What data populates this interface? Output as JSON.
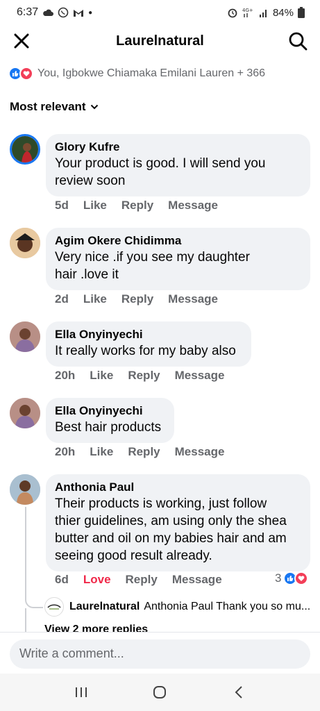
{
  "status_bar": {
    "time": "6:37",
    "battery": "84%"
  },
  "header": {
    "title": "Laurelnatural"
  },
  "reactions": {
    "summary": "You, Igbokwe Chiamaka Emilani Lauren + 366"
  },
  "sort": {
    "label": "Most relevant"
  },
  "comments": [
    {
      "author": "Glory Kufre",
      "lines": [
        "Your product is good. I will send you",
        "review soon"
      ],
      "time": "5d",
      "like": "Like",
      "reply": "Reply",
      "message": "Message"
    },
    {
      "author": "Agim Okere Chidimma",
      "lines": [
        "Very nice .if you see my daughter",
        "hair .love it"
      ],
      "time": "2d",
      "like": "Like",
      "reply": "Reply",
      "message": "Message"
    },
    {
      "author": "Ella Onyinyechi",
      "lines": [
        "It really works for my baby also"
      ],
      "time": "20h",
      "like": "Like",
      "reply": "Reply",
      "message": "Message"
    },
    {
      "author": "Ella Onyinyechi",
      "lines": [
        "Best hair products"
      ],
      "time": "20h",
      "like": "Like",
      "reply": "Reply",
      "message": "Message"
    },
    {
      "author": "Anthonia Paul",
      "lines": [
        "Their products is working, just follow",
        "thier guidelines, am using only the shea",
        "butter and oil on my babies hair and am",
        "seeing good result already."
      ],
      "time": "6d",
      "like": "Love",
      "reply": "Reply",
      "message": "Message",
      "reaction_count": "3"
    }
  ],
  "reply": {
    "author": "Laurelnatural",
    "text": "Anthonia Paul Thank you so mu..."
  },
  "view_more": "View 2 more replies",
  "composer": {
    "placeholder": "Write a comment..."
  },
  "colors": {
    "accent": "#1877f2",
    "love": "#f02849",
    "bubble": "#f0f2f5"
  }
}
